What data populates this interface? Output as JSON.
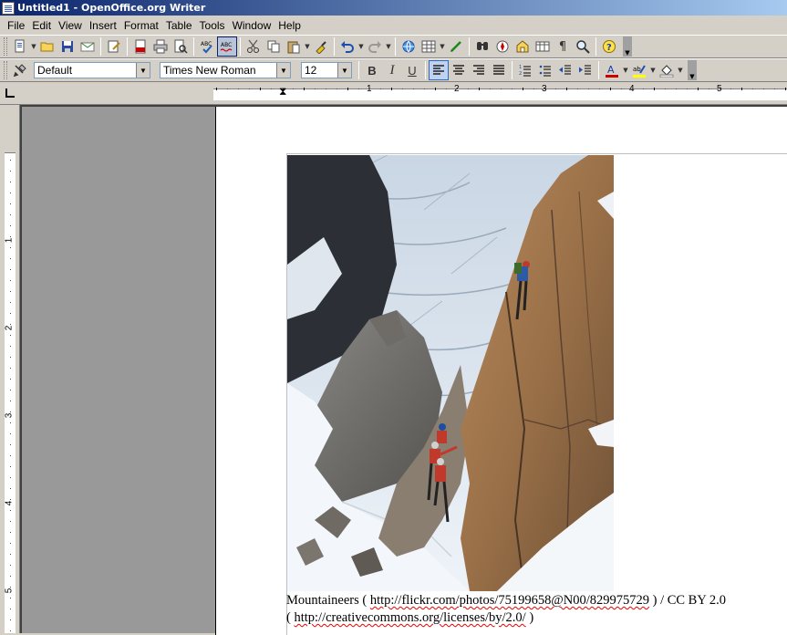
{
  "window": {
    "title": "Untitled1 - OpenOffice.org Writer"
  },
  "menu": {
    "items": [
      "File",
      "Edit",
      "View",
      "Insert",
      "Format",
      "Table",
      "Tools",
      "Window",
      "Help"
    ]
  },
  "formatting": {
    "paragraph_style": "Default",
    "font_name": "Times New Roman",
    "font_size": "12"
  },
  "ruler": {
    "horizontal_numbers": [
      "1",
      "2",
      "3",
      "4",
      "5"
    ],
    "vertical_numbers": [
      "1",
      "2",
      "3",
      "4",
      "5"
    ]
  },
  "document": {
    "image_icon": "mountaineers-photo",
    "caption_prefix": "Mountaineers ( ",
    "caption_url1": "http://flickr.com/photos/75199658@N00/829975729",
    "caption_middle": " ) / CC BY 2.0",
    "caption_line2_open": "( ",
    "caption_url2": "http://creativecommons.org/licenses/by/2.0/",
    "caption_line2_close": " )"
  },
  "colors": {
    "title_bar_start": "#0a246a",
    "title_bar_end": "#a6caf0",
    "page_background": "#ffffff",
    "workspace_gray": "#999999",
    "font_color_accent": "#cc0000",
    "highlight_accent": "#ffff00"
  }
}
